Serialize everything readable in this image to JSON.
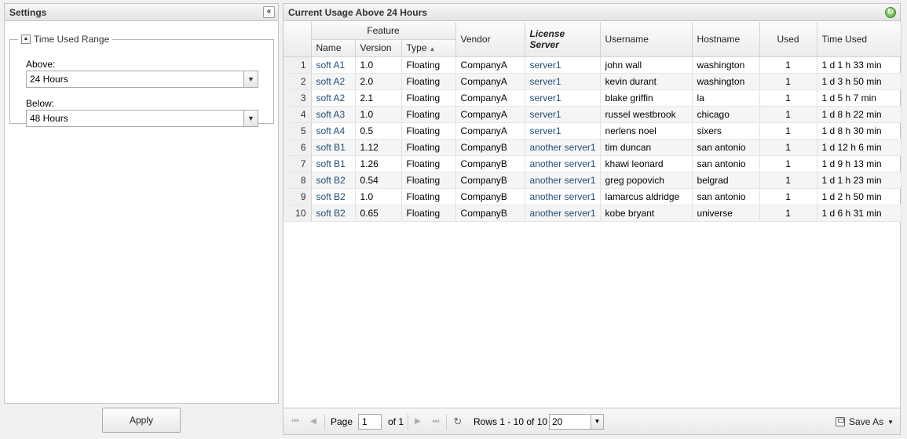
{
  "settings": {
    "title": "Settings",
    "fieldset_legend": "Time Used Range",
    "above_label": "Above:",
    "above_value": "24 Hours",
    "below_label": "Below:",
    "below_value": "48 Hours",
    "apply_label": "Apply"
  },
  "grid": {
    "title": "Current Usage Above 24 Hours",
    "group_header": "Feature",
    "columns": {
      "name": "Name",
      "version": "Version",
      "type": "Type",
      "vendor": "Vendor",
      "license_server": "License Server",
      "username": "Username",
      "hostname": "Hostname",
      "used": "Used",
      "time_used": "Time Used"
    },
    "rows": [
      {
        "n": "1",
        "name": "soft A1",
        "version": "1.0",
        "type": "Floating",
        "vendor": "CompanyA",
        "server": "server1",
        "user": "john wall",
        "host": "washington",
        "used": "1",
        "time": "1 d 1 h 33 min"
      },
      {
        "n": "2",
        "name": "soft A2",
        "version": "2.0",
        "type": "Floating",
        "vendor": "CompanyA",
        "server": "server1",
        "user": "kevin durant",
        "host": "washington",
        "used": "1",
        "time": "1 d 3 h 50 min"
      },
      {
        "n": "3",
        "name": "soft A2",
        "version": "2.1",
        "type": "Floating",
        "vendor": "CompanyA",
        "server": "server1",
        "user": "blake griffin",
        "host": "la",
        "used": "1",
        "time": "1 d 5 h 7 min"
      },
      {
        "n": "4",
        "name": "soft A3",
        "version": "1.0",
        "type": "Floating",
        "vendor": "CompanyA",
        "server": "server1",
        "user": "russel westbrook",
        "host": "chicago",
        "used": "1",
        "time": "1 d 8 h 22 min"
      },
      {
        "n": "5",
        "name": "soft A4",
        "version": "0.5",
        "type": "Floating",
        "vendor": "CompanyA",
        "server": "server1",
        "user": "nerlens noel",
        "host": "sixers",
        "used": "1",
        "time": "1 d 8 h 30 min"
      },
      {
        "n": "6",
        "name": "soft B1",
        "version": "1.12",
        "type": "Floating",
        "vendor": "CompanyB",
        "server": "another server1",
        "user": "tim duncan",
        "host": "san antonio",
        "used": "1",
        "time": "1 d 12 h 6 min"
      },
      {
        "n": "7",
        "name": "soft B1",
        "version": "1.26",
        "type": "Floating",
        "vendor": "CompanyB",
        "server": "another server1",
        "user": "khawi leonard",
        "host": "san antonio",
        "used": "1",
        "time": "1 d 9 h 13 min"
      },
      {
        "n": "8",
        "name": "soft B2",
        "version": "0.54",
        "type": "Floating",
        "vendor": "CompanyB",
        "server": "another server1",
        "user": "greg popovich",
        "host": "belgrad",
        "used": "1",
        "time": "1 d 1 h 23 min"
      },
      {
        "n": "9",
        "name": "soft B2",
        "version": "1.0",
        "type": "Floating",
        "vendor": "CompanyB",
        "server": "another server1",
        "user": "lamarcus aldridge",
        "host": "san antonio",
        "used": "1",
        "time": "1 d 2 h 50 min"
      },
      {
        "n": "10",
        "name": "soft B2",
        "version": "0.65",
        "type": "Floating",
        "vendor": "CompanyB",
        "server": "another server1",
        "user": "kobe bryant",
        "host": "universe",
        "used": "1",
        "time": "1 d 6 h 31 min"
      }
    ]
  },
  "pager": {
    "page_label": "Page",
    "page_value": "1",
    "of_label": "of 1",
    "rows_info": "Rows 1 - 10 of 10",
    "page_size": "20",
    "save_as_label": "Save As"
  },
  "icons": {
    "collapse": "double-chevron-left-icon",
    "refresh": "green-refresh-icon",
    "legend_toggle": "triangle-up-icon"
  }
}
